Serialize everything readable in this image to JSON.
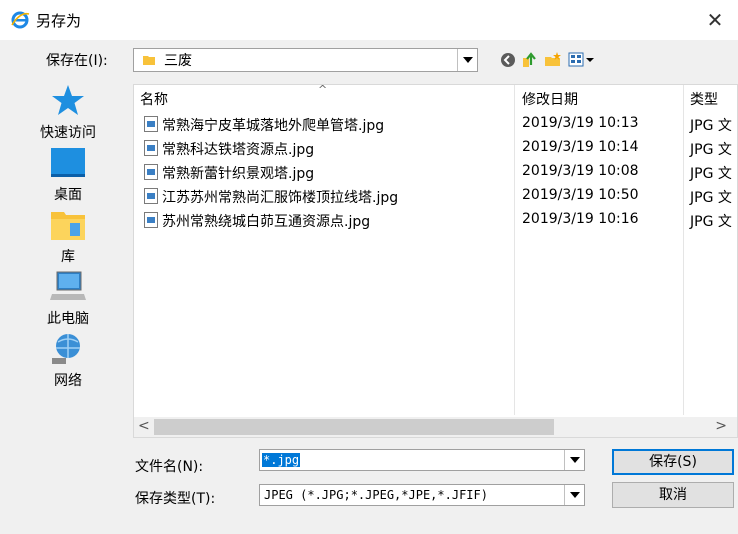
{
  "window": {
    "title": "另存为",
    "close": "✕"
  },
  "save_in": {
    "label": "保存在(I):",
    "value": "三废"
  },
  "places": [
    {
      "label": "快速访问"
    },
    {
      "label": "桌面"
    },
    {
      "label": "库"
    },
    {
      "label": "此电脑"
    },
    {
      "label": "网络"
    }
  ],
  "columns": {
    "name": "名称",
    "date": "修改日期",
    "type": "类型"
  },
  "files": [
    {
      "name": "常熟海宁皮革城落地外爬单管塔.jpg",
      "date": "2019/3/19 10:13",
      "type": "JPG 文"
    },
    {
      "name": "常熟科达铁塔资源点.jpg",
      "date": "2019/3/19 10:14",
      "type": "JPG 文"
    },
    {
      "name": "常熟新蕾针织景观塔.jpg",
      "date": "2019/3/19 10:08",
      "type": "JPG 文"
    },
    {
      "name": "江苏苏州常熟尚汇服饰楼顶拉线塔.jpg",
      "date": "2019/3/19 10:50",
      "type": "JPG 文"
    },
    {
      "name": "苏州常熟绕城白茆互通资源点.jpg",
      "date": "2019/3/19 10:16",
      "type": "JPG 文"
    }
  ],
  "filename": {
    "label": "文件名(N):",
    "value": "*.jpg"
  },
  "filetype": {
    "label": "保存类型(T):",
    "value": "JPEG (*.JPG;*.JPEG,*JPE,*.JFIF)"
  },
  "buttons": {
    "save": "保存(S)",
    "cancel": "取消"
  },
  "colors": {
    "accent": "#0078d7",
    "folder": "#f8c23a"
  }
}
